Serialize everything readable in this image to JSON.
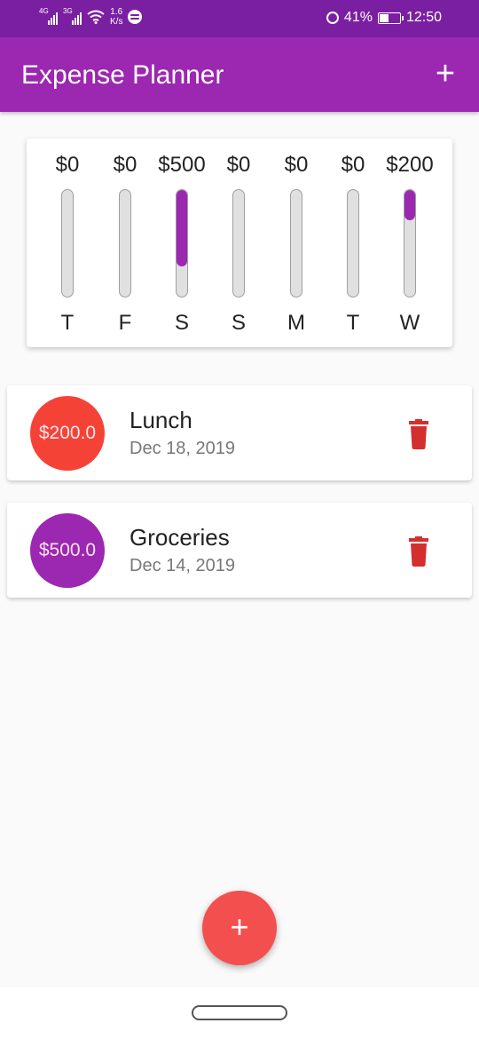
{
  "status_bar": {
    "network_tag_1": "4G",
    "network_tag_2": "3G",
    "speed_value": "1.6",
    "speed_unit": "K/s",
    "battery_percent": "41%",
    "time": "12:50",
    "icons": [
      "signal-icon",
      "signal-icon",
      "wifi-icon",
      "spotify-icon",
      "alarm-icon",
      "battery-icon"
    ]
  },
  "app_bar": {
    "title": "Expense Planner",
    "add_icon": "+"
  },
  "weekly_chart": {
    "accent_color": "#9c27b0",
    "bars": [
      {
        "day": "T",
        "amount": "$0",
        "fraction": 0
      },
      {
        "day": "F",
        "amount": "$0",
        "fraction": 0
      },
      {
        "day": "S",
        "amount": "$500",
        "fraction": 0.714
      },
      {
        "day": "S",
        "amount": "$0",
        "fraction": 0
      },
      {
        "day": "M",
        "amount": "$0",
        "fraction": 0
      },
      {
        "day": "T",
        "amount": "$0",
        "fraction": 0
      },
      {
        "day": "W",
        "amount": "$200",
        "fraction": 0.286
      }
    ]
  },
  "transactions": [
    {
      "amount": "$200.0",
      "title": "Lunch",
      "date": "Dec 18, 2019",
      "color": "#f44336",
      "delete_icon": "trash-icon"
    },
    {
      "amount": "$500.0",
      "title": "Groceries",
      "date": "Dec 14, 2019",
      "color": "#9c27b0",
      "delete_icon": "trash-icon"
    }
  ],
  "fab": {
    "label": "+",
    "color": "#f44f4f"
  }
}
